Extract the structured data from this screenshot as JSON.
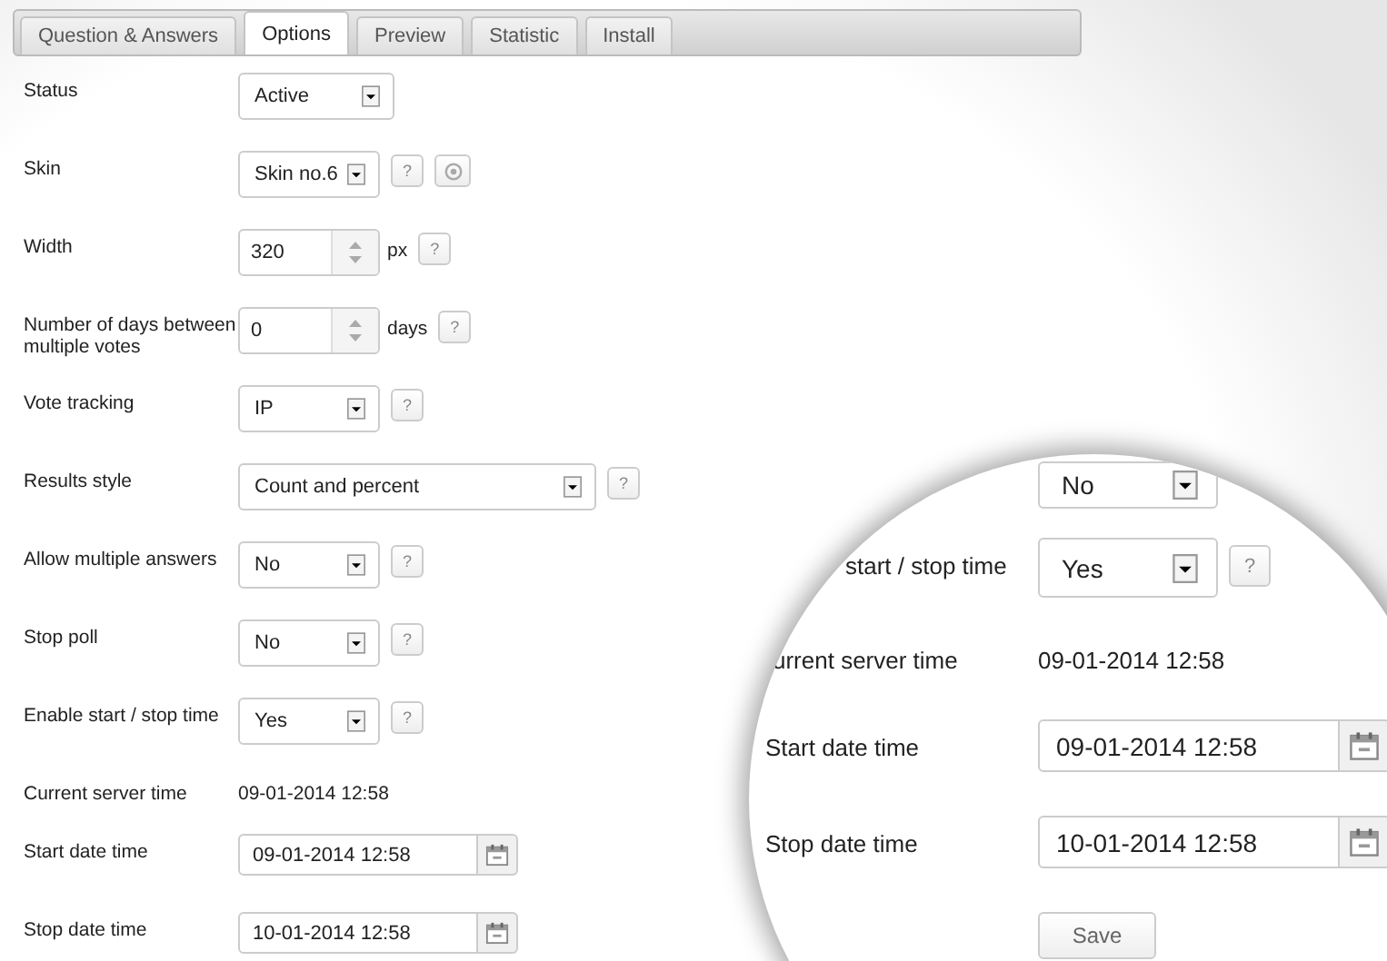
{
  "tabs": [
    {
      "label": "Question & Answers",
      "selected": false
    },
    {
      "label": "Options",
      "selected": true
    },
    {
      "label": "Preview",
      "selected": false
    },
    {
      "label": "Statistic",
      "selected": false
    },
    {
      "label": "Install",
      "selected": false
    }
  ],
  "fields": [
    {
      "kind": "select",
      "label": "Status",
      "value": "Active"
    },
    {
      "kind": "select",
      "label": "Skin",
      "value": "Skin no.6",
      "help": "?",
      "preview": true
    },
    {
      "kind": "spinner",
      "label": "Width",
      "value": "320",
      "unit": "px",
      "help": "?"
    },
    {
      "kind": "spinner",
      "label": "Number of days between multiple votes",
      "value": "0",
      "unit": "days",
      "help": "?"
    },
    {
      "kind": "select",
      "label": "Vote tracking",
      "value": "IP",
      "help": "?"
    },
    {
      "kind": "select",
      "label": "Results style",
      "value": "Count and percent",
      "help": "?"
    },
    {
      "kind": "select",
      "label": "Allow multiple answers",
      "value": "No",
      "help": "?"
    },
    {
      "kind": "select",
      "label": "Stop poll",
      "value": "No",
      "help": "?"
    },
    {
      "kind": "select",
      "label": "Enable start / stop time",
      "value": "Yes",
      "help": "?"
    },
    {
      "kind": "text",
      "label": "Current server time",
      "value": "09-01-2014 12:58"
    },
    {
      "kind": "datetime",
      "label": "Start date time",
      "value": "09-01-2014 12:58"
    },
    {
      "kind": "datetime",
      "label": "Stop date time",
      "value": "10-01-2014 12:58"
    }
  ],
  "magnifier": {
    "rows": [
      {
        "kind": "select",
        "value": "No"
      },
      {
        "kind": "select",
        "label": "start / stop time",
        "value": "Yes",
        "help": "?"
      },
      {
        "kind": "text",
        "label": "urrent server time",
        "value": "09-01-2014 12:58"
      },
      {
        "kind": "datetime",
        "label": "Start date time",
        "value": "09-01-2014 12:58"
      },
      {
        "kind": "datetime",
        "label": "Stop date time",
        "value": "10-01-2014 12:58"
      }
    ],
    "save_button": "Save"
  }
}
